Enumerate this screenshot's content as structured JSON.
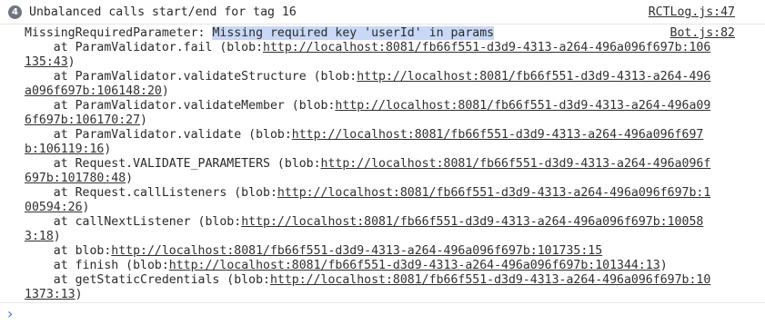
{
  "log_row": {
    "count": "4",
    "message": "Unbalanced calls start/end for tag 16",
    "source": "RCTLog.js:47"
  },
  "error": {
    "name": "MissingRequiredParameter: ",
    "message": "Missing required key 'userId' in params",
    "source": "Bot.js:82",
    "frames": [
      {
        "lines": [
          {
            "pre": "    at ParamValidator.fail (blob:",
            "link": "http://localhost:8081/fb66f551-d3d9-4313-a264-496a096f697b:106",
            "post": ""
          },
          {
            "pre": "",
            "link": "135:43",
            "post": ")"
          }
        ]
      },
      {
        "lines": [
          {
            "pre": "    at ParamValidator.validateStructure (blob:",
            "link": "http://localhost:8081/fb66f551-d3d9-4313-a264-496",
            "post": ""
          },
          {
            "pre": "",
            "link": "a096f697b:106148:20",
            "post": ")"
          }
        ]
      },
      {
        "lines": [
          {
            "pre": "    at ParamValidator.validateMember (blob:",
            "link": "http://localhost:8081/fb66f551-d3d9-4313-a264-496a09",
            "post": ""
          },
          {
            "pre": "",
            "link": "6f697b:106170:27",
            "post": ")"
          }
        ]
      },
      {
        "lines": [
          {
            "pre": "    at ParamValidator.validate (blob:",
            "link": "http://localhost:8081/fb66f551-d3d9-4313-a264-496a096f697",
            "post": ""
          },
          {
            "pre": "",
            "link": "b:106119:16",
            "post": ")"
          }
        ]
      },
      {
        "lines": [
          {
            "pre": "    at Request.VALIDATE_PARAMETERS (blob:",
            "link": "http://localhost:8081/fb66f551-d3d9-4313-a264-496a096f",
            "post": ""
          },
          {
            "pre": "",
            "link": "697b:101780:48",
            "post": ")"
          }
        ]
      },
      {
        "lines": [
          {
            "pre": "    at Request.callListeners (blob:",
            "link": "http://localhost:8081/fb66f551-d3d9-4313-a264-496a096f697b:1",
            "post": ""
          },
          {
            "pre": "",
            "link": "00594:26",
            "post": ")"
          }
        ]
      },
      {
        "lines": [
          {
            "pre": "    at callNextListener (blob:",
            "link": "http://localhost:8081/fb66f551-d3d9-4313-a264-496a096f697b:10058",
            "post": ""
          },
          {
            "pre": "",
            "link": "3:18",
            "post": ")"
          }
        ]
      },
      {
        "lines": [
          {
            "pre": "    at blob:",
            "link": "http://localhost:8081/fb66f551-d3d9-4313-a264-496a096f697b:101735:15",
            "post": ""
          }
        ]
      },
      {
        "lines": [
          {
            "pre": "    at finish (blob:",
            "link": "http://localhost:8081/fb66f551-d3d9-4313-a264-496a096f697b:101344:13",
            "post": ")"
          }
        ]
      },
      {
        "lines": [
          {
            "pre": "    at getStaticCredentials (blob:",
            "link": "http://localhost:8081/fb66f551-d3d9-4313-a264-496a096f697b:10",
            "post": ""
          },
          {
            "pre": "",
            "link": "1373:13",
            "post": ")"
          }
        ]
      }
    ]
  },
  "prompt": {
    "icon": "chevron-right-icon",
    "glyph": "›",
    "accent": "#3b6ee3"
  }
}
